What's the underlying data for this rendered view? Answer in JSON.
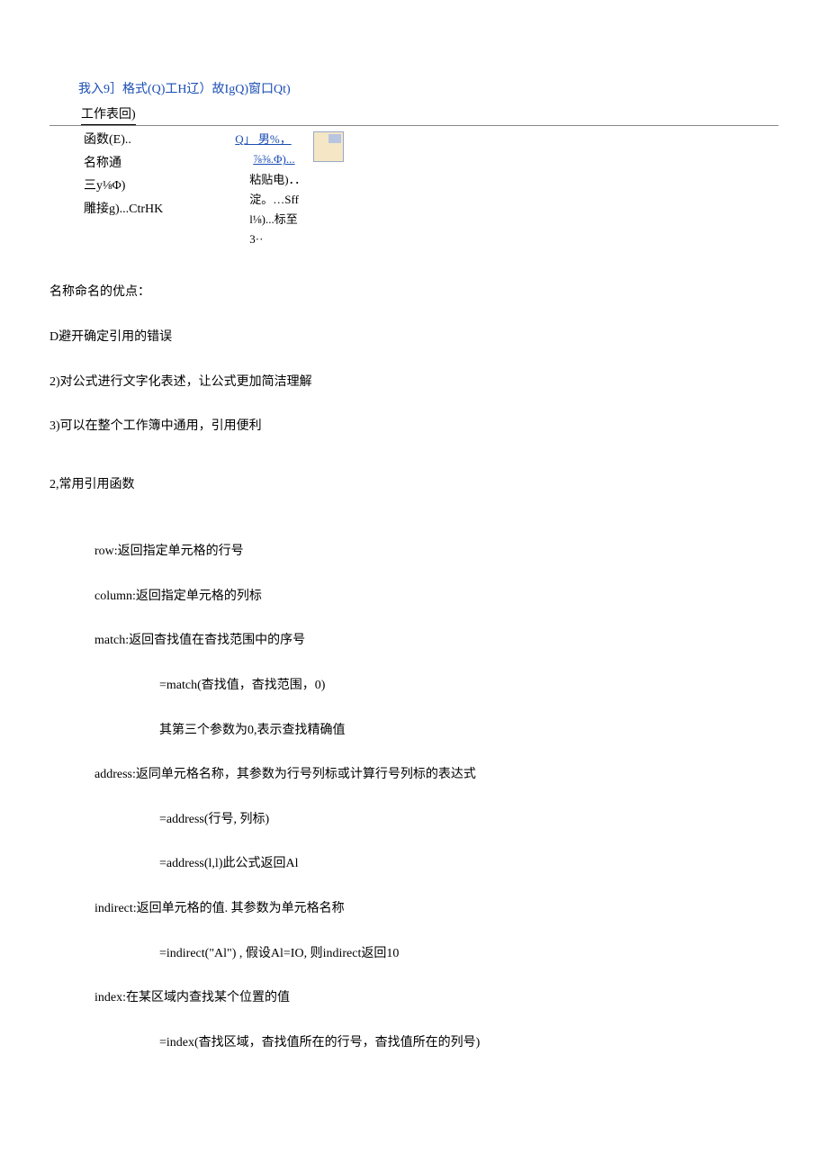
{
  "menuBar": "我入9］格式(Q)工H辽）故IgQ)窗口Qt)",
  "submenu": {
    "worksheet": "工作表回)"
  },
  "leftCol": {
    "line1": "函数(E)..",
    "line2": "名称通",
    "line3": "三y⅛Φ)",
    "line4": "雕接g)...CtrHK"
  },
  "rightCol": {
    "link1": "Q」   男%，",
    "link2": "⅞⅜.Φ)...",
    "line3": "粘贴电)．．",
    "line4": "淀。…Sff",
    "line5": "l⅛)...标至",
    "line6": "3··"
  },
  "advantagesTitle": "名称命名的优点：",
  "adv1": "D避开确定引用的错误",
  "adv2": "2)对公式进行文字化表述，让公式更加简洁理解",
  "adv3": "3)可以在整个工作簿中通用，引用便利",
  "section2Title": "2,常用引用函数",
  "funcs": {
    "row": "row:返回指定单元格的行号",
    "column": "column:返回指定单元格的列标",
    "match": "match:返回杳找值在杳找范围中的序号",
    "matchFormula": "=match(杳找值，杳找范围，0)",
    "matchNote": "其第三个参数为0,表示查找精确值",
    "address": "address:返同单元格名称，其参数为行号列标或计算行号列标的表达式",
    "addressF1": "=address(行号, 列标)",
    "addressF2": "=address(l,l)此公式返回Al",
    "indirect": "indirect:返回单元格的值. 其参数为单元格名称",
    "indirectF": "=indirect(\"Al\") , 假设Al=IO, 则indirect返回10",
    "index": "index:在某区域内查找某个位置的值",
    "indexF": "=index(杳找区域，杳找值所在的行号，杳找值所在的列号)"
  }
}
